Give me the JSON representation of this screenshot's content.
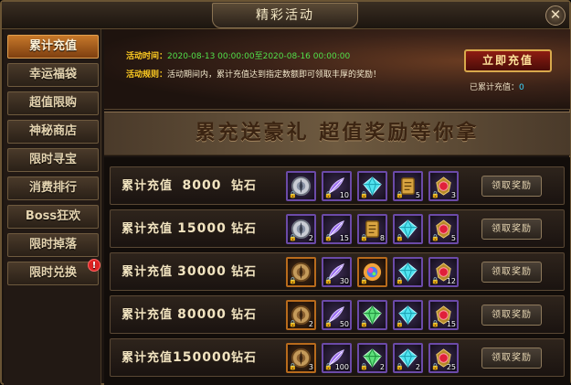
{
  "window": {
    "title": "精彩活动",
    "close_label": "✕"
  },
  "sidebar": {
    "items": [
      {
        "label": "累计充值",
        "active": true,
        "badge": ""
      },
      {
        "label": "幸运福袋",
        "active": false,
        "badge": ""
      },
      {
        "label": "超值限购",
        "active": false,
        "badge": ""
      },
      {
        "label": "神秘商店",
        "active": false,
        "badge": ""
      },
      {
        "label": "限时寻宝",
        "active": false,
        "badge": ""
      },
      {
        "label": "消费排行",
        "active": false,
        "badge": ""
      },
      {
        "label": "Boss狂欢",
        "active": false,
        "badge": ""
      },
      {
        "label": "限时掉落",
        "active": false,
        "badge": ""
      },
      {
        "label": "限时兑换",
        "active": false,
        "badge": "!"
      }
    ]
  },
  "banner": {
    "time_label": "活动时间：",
    "time_value": "2020-08-13 00:00:00至2020-08-16 00:00:00",
    "rule_label": "活动规则：",
    "rule_value": "活动期间内，累计充值达到指定数额即可领取丰厚的奖励！",
    "recharge_button": "立即充值",
    "accumulated_label": "已累计充值：",
    "accumulated_value": "0"
  },
  "slogan": "累充送豪礼  超值奖励等你拿",
  "colors": {
    "accent": "#ffcc22",
    "time_green": "#52e04a",
    "value_cyan": "#3ad6ff"
  },
  "rewards": [
    {
      "prefix": "累计充值",
      "amount": "8000",
      "unit": "钻石",
      "claim_label": "领取奖励",
      "items": [
        {
          "icon": "silver-compass-icon",
          "count": "",
          "rarity": "purple"
        },
        {
          "icon": "purple-feather-icon",
          "count": "10",
          "rarity": "purple"
        },
        {
          "icon": "cyan-diamond-icon",
          "count": "",
          "rarity": "purple"
        },
        {
          "icon": "golden-scroll-icon",
          "count": "5",
          "rarity": "purple"
        },
        {
          "icon": "red-gem-amulet-icon",
          "count": "3",
          "rarity": "purple"
        }
      ]
    },
    {
      "prefix": "累计充值",
      "amount": "15000",
      "unit": "钻石",
      "claim_label": "领取奖励",
      "items": [
        {
          "icon": "silver-compass-icon",
          "count": "2",
          "rarity": "purple"
        },
        {
          "icon": "purple-feather-icon",
          "count": "15",
          "rarity": "purple"
        },
        {
          "icon": "golden-scroll-icon",
          "count": "8",
          "rarity": "purple"
        },
        {
          "icon": "cyan-diamond-icon",
          "count": "",
          "rarity": "purple"
        },
        {
          "icon": "red-gem-amulet-icon",
          "count": "5",
          "rarity": "purple"
        }
      ]
    },
    {
      "prefix": "累计充值",
      "amount": "30000",
      "unit": "钻石",
      "claim_label": "领取奖励",
      "items": [
        {
          "icon": "bronze-compass-icon",
          "count": "",
          "rarity": "orange"
        },
        {
          "icon": "purple-feather-icon",
          "count": "30",
          "rarity": "purple"
        },
        {
          "icon": "rainbow-orb-icon",
          "count": "",
          "rarity": "orange"
        },
        {
          "icon": "cyan-diamond-icon",
          "count": "",
          "rarity": "purple"
        },
        {
          "icon": "red-gem-amulet-icon",
          "count": "12",
          "rarity": "purple"
        }
      ]
    },
    {
      "prefix": "累计充值",
      "amount": "80000",
      "unit": "钻石",
      "claim_label": "领取奖励",
      "items": [
        {
          "icon": "bronze-compass-icon",
          "count": "2",
          "rarity": "orange"
        },
        {
          "icon": "purple-feather-icon",
          "count": "50",
          "rarity": "purple"
        },
        {
          "icon": "green-diamond-icon",
          "count": "",
          "rarity": "purple"
        },
        {
          "icon": "cyan-diamond-icon",
          "count": "",
          "rarity": "purple"
        },
        {
          "icon": "red-gem-amulet-icon",
          "count": "15",
          "rarity": "purple"
        }
      ]
    },
    {
      "prefix": "累计充值",
      "amount": "150000",
      "unit": "钻石",
      "claim_label": "领取奖励",
      "items": [
        {
          "icon": "bronze-compass-icon",
          "count": "3",
          "rarity": "orange"
        },
        {
          "icon": "purple-feather-icon",
          "count": "100",
          "rarity": "purple"
        },
        {
          "icon": "green-diamond-icon",
          "count": "2",
          "rarity": "purple"
        },
        {
          "icon": "cyan-diamond-icon",
          "count": "2",
          "rarity": "purple"
        },
        {
          "icon": "red-gem-amulet-icon",
          "count": "25",
          "rarity": "purple"
        }
      ]
    }
  ]
}
